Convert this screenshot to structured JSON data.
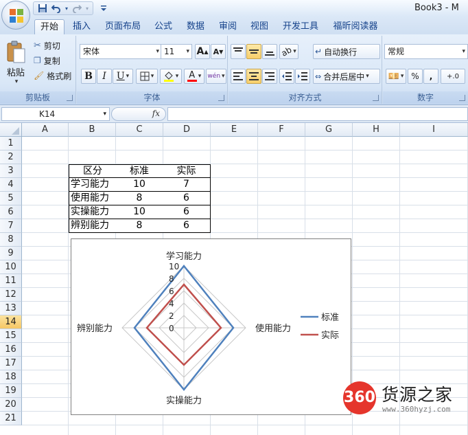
{
  "title_bar": {
    "document_title": "Book3 - M",
    "quick_access": [
      "save-icon",
      "undo-icon",
      "redo-icon",
      "customize-qat-icon"
    ]
  },
  "tabs": [
    {
      "label": "开始",
      "active": true
    },
    {
      "label": "插入"
    },
    {
      "label": "页面布局"
    },
    {
      "label": "公式"
    },
    {
      "label": "数据"
    },
    {
      "label": "审阅"
    },
    {
      "label": "视图"
    },
    {
      "label": "开发工具"
    },
    {
      "label": "福昕阅读器"
    }
  ],
  "ribbon": {
    "clipboard": {
      "label": "剪贴板",
      "paste": "粘贴",
      "cut": "剪切",
      "copy": "复制",
      "format_painter": "格式刷"
    },
    "font": {
      "label": "字体",
      "font_name": "宋体",
      "font_size": "11",
      "grow": "A",
      "shrink": "A",
      "bold": "B",
      "italic": "I",
      "underline": "U",
      "font_color_glyph": "A",
      "phonetic": "wén"
    },
    "alignment": {
      "label": "对齐方式",
      "wrap_text": "自动换行",
      "merge_center": "合并后居中"
    },
    "number": {
      "label": "数字",
      "format": "常规",
      "percent": "%",
      "comma": ",",
      "increase_decimal": "+.0"
    }
  },
  "formula_bar": {
    "name_box": "K14",
    "fx": "fx",
    "formula": ""
  },
  "sheet": {
    "columns": [
      "A",
      "B",
      "C",
      "D",
      "E",
      "F",
      "G",
      "H",
      "I"
    ],
    "rows": [
      "1",
      "2",
      "3",
      "4",
      "5",
      "6",
      "7",
      "8",
      "9",
      "10",
      "11",
      "12",
      "13",
      "14",
      "15",
      "16",
      "17",
      "18",
      "19",
      "20",
      "21"
    ],
    "active_row": "14",
    "table": {
      "header": [
        "区分",
        "标准",
        "实际"
      ],
      "rows": [
        [
          "学习能力",
          "10",
          "7"
        ],
        [
          "使用能力",
          "8",
          "6"
        ],
        [
          "实操能力",
          "10",
          "6"
        ],
        [
          "辨别能力",
          "8",
          "6"
        ]
      ]
    }
  },
  "chart_data": {
    "type": "radar",
    "categories": [
      "学习能力",
      "使用能力",
      "实操能力",
      "辨别能力"
    ],
    "series": [
      {
        "name": "标准",
        "values": [
          10,
          8,
          10,
          8
        ],
        "color": "#4f81bd"
      },
      {
        "name": "实际",
        "values": [
          7,
          6,
          6,
          6
        ],
        "color": "#c0504d"
      }
    ],
    "radial_ticks": [
      "0",
      "2",
      "4",
      "6",
      "8",
      "10"
    ],
    "range": [
      0,
      10
    ],
    "legend_position": "right",
    "gridlines": true
  },
  "watermark": {
    "badge": "360",
    "name": "货源之家",
    "url": "www.360hyzj.com"
  }
}
